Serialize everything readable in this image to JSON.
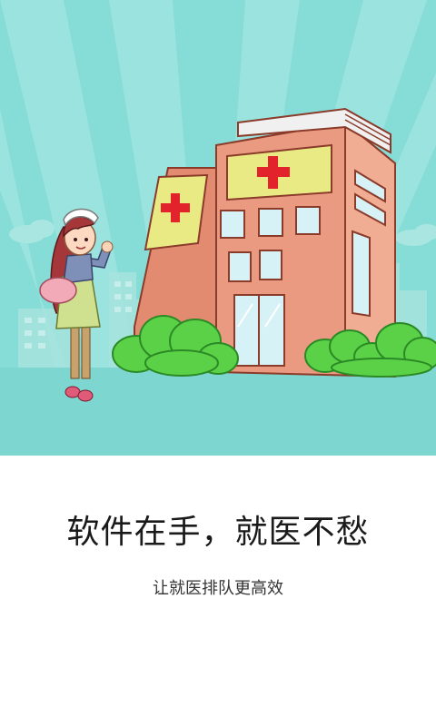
{
  "splash": {
    "headline": "软件在手，就医不愁",
    "subline": "让就医排队更高效"
  },
  "illustration": {
    "sky_color": "#86dcd6",
    "ground_color": "#7dd6cf",
    "building_color": "#e99a80",
    "sign_color": "#e9ea83",
    "cross_color": "#e2232b",
    "bush_color": "#5ad146"
  },
  "icons": [
    "hospital-building-illustration",
    "girl-character-illustration",
    "red-cross-icon",
    "bush-illustration"
  ]
}
